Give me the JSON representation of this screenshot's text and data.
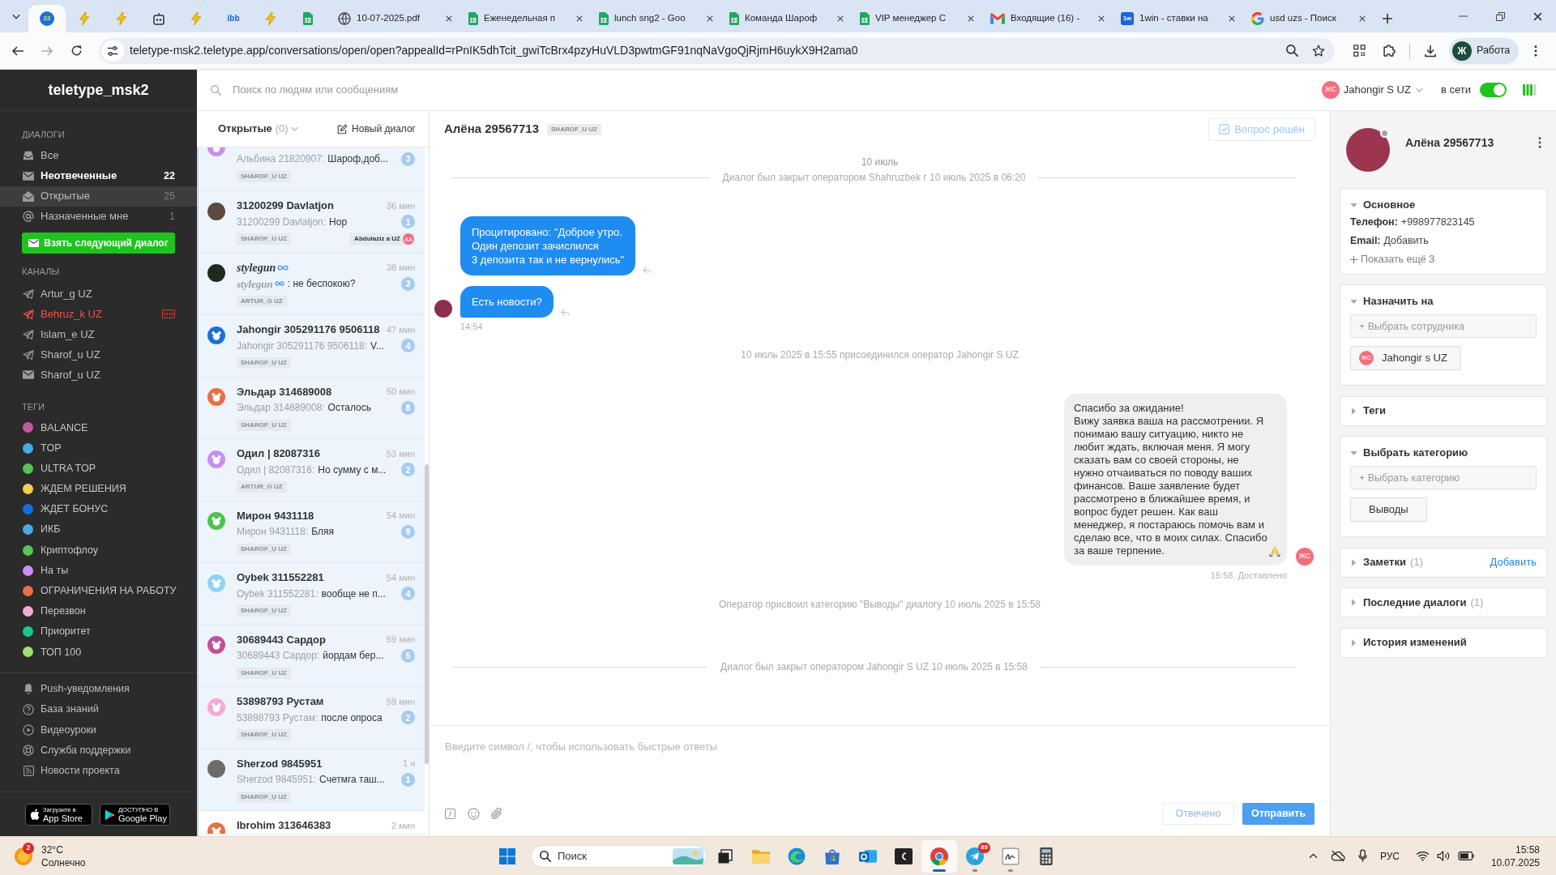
{
  "browser": {
    "pinned_tabs": [
      {
        "kind": "counter",
        "logo": "22",
        "selected": true
      },
      {
        "kind": "bolt",
        "selected": false
      },
      {
        "kind": "bolt",
        "selected": false
      },
      {
        "kind": "robot",
        "selected": false
      },
      {
        "kind": "bolt",
        "selected": false
      },
      {
        "kind": "text",
        "logo": "ibb",
        "selected": false
      },
      {
        "kind": "bolt",
        "selected": false
      },
      {
        "kind": "sheets",
        "selected": false
      }
    ],
    "tabs": [
      {
        "kind": "globe",
        "title": "10-07-2025.pdf",
        "selected": false
      },
      {
        "kind": "sheets",
        "title": "Еженедельная п",
        "selected": false
      },
      {
        "kind": "sheets",
        "title": "lunch sng2 - Goo",
        "selected": false
      },
      {
        "kind": "sheets",
        "title": "Команда Шароф",
        "selected": false
      },
      {
        "kind": "sheets",
        "title": "VIP менеджер С",
        "selected": false
      },
      {
        "kind": "gmail",
        "title": "Входящие (16) -",
        "selected": false
      },
      {
        "kind": "tile",
        "logo": "1w",
        "title": "1win - ставки на",
        "selected": false
      },
      {
        "kind": "google",
        "title": "usd uzs - Поиск",
        "selected": false
      }
    ],
    "url": "teletype-msk2.teletype.app/conversations/open/open?appealId=rPnIK5dhTcit_gwiTcBrx4pzyHuVLD3pwtmGF91nqNaVgoQjRjmH6uykX9H2ama0",
    "profile": {
      "initial": "Ж",
      "label": "Работа"
    }
  },
  "sidebar": {
    "title": "teletype_msk2",
    "dialogs_label": "ДИАЛОГИ",
    "dialogs": [
      {
        "kind": "inbox",
        "label": "Все",
        "selected": false,
        "highlighted": false
      },
      {
        "kind": "envelope",
        "label": "Неотвеченные",
        "count": "22",
        "selected": false,
        "highlighted": true
      },
      {
        "kind": "envelope_open",
        "label": "Открытые",
        "count": "25",
        "selected": true,
        "highlighted": false
      },
      {
        "kind": "at",
        "label": "Назначенные мне",
        "count": "1",
        "selected": false,
        "highlighted": false
      }
    ],
    "next_button": "Взять следующий диалог",
    "channels_label": "КАНАЛЫ",
    "channels": [
      {
        "kind": "telegram",
        "label": "Artur_g UZ",
        "alert": false
      },
      {
        "kind": "telegram",
        "label": "Behruz_k UZ",
        "alert": true
      },
      {
        "kind": "telegram",
        "label": "Islam_e UZ",
        "alert": false
      },
      {
        "kind": "telegram",
        "label": "Sharof_u UZ",
        "alert": false
      },
      {
        "kind": "email",
        "label": "Sharof_u UZ",
        "alert": false
      }
    ],
    "tags_label": "ТЕГИ",
    "tags": [
      {
        "label": "BALANCE",
        "color": "#c8579e"
      },
      {
        "label": "TOP",
        "color": "#45ace6"
      },
      {
        "label": "ULTRA TOP",
        "color": "#55c454"
      },
      {
        "label": "ЖДЕМ РЕШЕНИЯ",
        "color": "#f6cd54"
      },
      {
        "label": "ЖДЕТ БОНУС",
        "color": "#0f6fe0"
      },
      {
        "label": "ИКБ",
        "color": "#45ace6"
      },
      {
        "label": "Криптофлоу",
        "color": "#55c454"
      },
      {
        "label": "На ты",
        "color": "#c98ef2"
      },
      {
        "label": "ОГРАНИЧЕНИЯ НА РАБОТУ",
        "color": "#ea6f45"
      },
      {
        "label": "Перезвон",
        "color": "#f7aad5"
      },
      {
        "label": "Приоритет",
        "color": "#17c98b"
      },
      {
        "label": "ТОП 100",
        "color": "#9fe06b"
      }
    ],
    "links": [
      {
        "kind": "bell",
        "label": "Push-уведомления"
      },
      {
        "kind": "help",
        "label": "База знаний"
      },
      {
        "kind": "play",
        "label": "Видеоуроки"
      },
      {
        "kind": "lifebuoy",
        "label": "Служба поддержки"
      },
      {
        "kind": "rss",
        "label": "Новости проекта"
      }
    ],
    "stores": [
      {
        "kind": "apple",
        "caption": "Загрузите в",
        "label": "App Store"
      },
      {
        "kind": "google",
        "caption": "ДОСТУПНО В",
        "label": "Google Play"
      }
    ]
  },
  "topbar": {
    "search_placeholder": "Поиск по людям или сообщениям",
    "operator_initials": "ЖС",
    "operator_name": "Jahongir S UZ",
    "status_label": "в сети",
    "online": true
  },
  "conversations": {
    "filter": "Открытые",
    "filter_count": "(0)",
    "new_button": "Новый диалог",
    "items": [
      {
        "kind": "cut_top",
        "photo": false,
        "script": false,
        "infinity": false,
        "color": "#c98ef2",
        "author": "Альбина 21820907:",
        "text": "Шароф,доб...",
        "unread": "3",
        "channel": "SHAROF_U UZ",
        "highlighted": true
      },
      {
        "kind": "full",
        "photo": true,
        "script": false,
        "infinity": false,
        "color": "#5a4a40",
        "name": "31200299 Davlatjon",
        "time": "36 мин",
        "author": "31200299 Davlatjon:",
        "text": "Нор",
        "unread": "1",
        "channel": "SHAROF_U UZ",
        "assignee": {
          "name": "Abdulaziz a UZ",
          "initials": "AA"
        },
        "highlighted": true
      },
      {
        "kind": "full",
        "photo": true,
        "script": true,
        "infinity": true,
        "color": "#1d2a1c",
        "name": "stylegun",
        "time": "38 мин",
        "author": "stylegun",
        "text": ": не беспокою?",
        "unread": "3",
        "channel": "ARTUR_G UZ",
        "highlighted": true
      },
      {
        "kind": "full",
        "photo": false,
        "script": false,
        "infinity": false,
        "color": "#1a6fe0",
        "name": "Jahongir 305291176 9506118",
        "time": "47 мин",
        "author": "Jahongir 305291176 9506118:",
        "text": "V...",
        "unread": "4",
        "channel": "SHAROF_U UZ",
        "highlighted": true
      },
      {
        "kind": "full",
        "photo": false,
        "script": false,
        "infinity": false,
        "color": "#ea6f45",
        "name": "Эльдар 314689008",
        "time": "50 мин",
        "author": "Эльдар 314689008:",
        "text": "Осталось",
        "unread": "8",
        "channel": "SHAROF_U UZ",
        "highlighted": true
      },
      {
        "kind": "full",
        "photo": false,
        "script": false,
        "infinity": false,
        "color": "#c98ef2",
        "name": "Одил | 82087316",
        "time": "53 мин",
        "author": "Одил | 82087316:",
        "text": "Но сумму с м...",
        "unread": "2",
        "channel": "ARTUR_G UZ",
        "highlighted": true
      },
      {
        "kind": "full",
        "photo": false,
        "script": false,
        "infinity": false,
        "color": "#4cc44c",
        "name": "Мирон 9431118",
        "time": "54 мин",
        "author": "Мирон 9431118:",
        "text": "Бляя",
        "unread": "9",
        "channel": "SHAROF_U UZ",
        "highlighted": true
      },
      {
        "kind": "full",
        "photo": false,
        "script": false,
        "infinity": false,
        "color": "#8fd3f5",
        "name": "Oybek 311552281",
        "time": "54 мин",
        "author": "Oybek 311552281:",
        "text": "вообще не п...",
        "unread": "4",
        "channel": "SHAROF_U UZ",
        "highlighted": true
      },
      {
        "kind": "full",
        "photo": false,
        "script": false,
        "infinity": false,
        "color": "#c0509a",
        "name": "30689443 Сардор",
        "time": "59 мин",
        "author": "30689443 Сардор:",
        "text": "йордам бер...",
        "unread": "5",
        "channel": "SHAROF_U UZ",
        "highlighted": true
      },
      {
        "kind": "full",
        "photo": false,
        "script": false,
        "infinity": false,
        "color": "#f5a9d6",
        "name": "53898793 Рустам",
        "time": "59 мин",
        "author": "53898793 Рустам:",
        "text": "после опроса",
        "unread": "2",
        "channel": "SHAROF_U UZ",
        "highlighted": true
      },
      {
        "kind": "full",
        "photo": true,
        "script": false,
        "infinity": false,
        "color": "#6e6a66",
        "name": "Sherzod 9845951",
        "time": "1 ч",
        "author": "Sherzod 9845951:",
        "text": "Счетмга таш...",
        "unread": "1",
        "channel": "SHAROF_U UZ",
        "highlighted": true
      },
      {
        "kind": "cut_bottom",
        "photo": false,
        "script": false,
        "infinity": false,
        "color": "#ea6f45",
        "name": "Ibrohim 313646383",
        "time": "2 мин",
        "highlighted": false
      }
    ]
  },
  "chat": {
    "title": "Алёна 29567713",
    "channel": "SHAROF_U UZ",
    "resolve_button": {
      "label": "Вопрос решён",
      "disabled": true
    },
    "events": [
      {
        "kind": "date",
        "text": "10 июль"
      },
      {
        "kind": "divider",
        "text": "Диалог был закрыт оператором Shahruzbek г 10 июль 2025 в 06:20"
      },
      {
        "kind": "incoming",
        "text": "Процитировано: \"Доброе утро.\nОдин депозит зачислился\n3 депозита так и не вернулись\"",
        "avatar": false
      },
      {
        "kind": "incoming",
        "text": "Есть новости?",
        "avatar": true,
        "time": "14:54"
      },
      {
        "kind": "system",
        "text": "10 июль 2025 в 15:55 присоединился оператор Jahongir S UZ"
      },
      {
        "kind": "outgoing",
        "text": "Спасибо за ожидание!\nВижу заявка ваша на рассмотрении. Я понимаю вашу ситуацию, никто не любит ждать, включая меня. Я могу сказать вам со своей стороны, не нужно отчаиваться по поводу ваших финансов. Ваше заявление будет рассмотрено в ближайшее время, и вопрос будет решен. Как ваш менеджер, я постараюсь помочь вам и сделаю все, что в моих силах. Спасибо за ваше терпение.",
        "pray_icon": true,
        "initials": "ЖС",
        "status": "15:58. Доставлено"
      },
      {
        "kind": "system",
        "text": "Оператор присвоил категорию \"Выводы\" диалогу 10 июль 2025 в 15:58"
      },
      {
        "kind": "divider",
        "text": "Диалог был закрыт оператором Jahongir S UZ 10 июль 2025 в 15:58"
      }
    ],
    "input_placeholder": "Введите символ /, чтобы использовать быстрые ответы",
    "buttons": [
      {
        "kind": "secondary",
        "label": "Отвечено"
      },
      {
        "kind": "primary",
        "label": "Отправить"
      }
    ]
  },
  "contact": {
    "name": "Алёна 29567713",
    "online": false,
    "cards": [
      {
        "kind": "fields",
        "title": "Основное",
        "expanded": true,
        "fields": [
          {
            "label": "Телефон:",
            "value": "+998977823145"
          },
          {
            "label": "Email:",
            "value": "Добавить"
          }
        ],
        "more": "Показать ещё 3"
      },
      {
        "kind": "assign",
        "title": "Назначить на",
        "expanded": true,
        "placeholder": "+ Выбрать сотрудника",
        "chips": [
          {
            "initials": "ЖС",
            "label": "Jahongir s UZ"
          }
        ]
      },
      {
        "kind": "plain",
        "title": "Теги",
        "expanded": false
      },
      {
        "kind": "assign",
        "title": "Выбрать категорию",
        "expanded": true,
        "placeholder": "+ Выбрать категорию",
        "chips": [
          {
            "label": "Выводы"
          }
        ]
      },
      {
        "kind": "plain",
        "title": "Заметки",
        "count": "(1)",
        "action": "Добавить",
        "expanded": false
      },
      {
        "kind": "plain",
        "title": "Последние диалоги",
        "count": "(1)",
        "expanded": false
      },
      {
        "kind": "plain",
        "title": "История изменений",
        "expanded": false
      }
    ]
  },
  "taskbar": {
    "weather": {
      "badge": "2",
      "temperature": "32°C",
      "condition": "Солнечно"
    },
    "search_placeholder": "Поиск",
    "apps": [
      {
        "kind": "taskview",
        "selected": false,
        "running": false
      },
      {
        "kind": "explorer",
        "selected": false,
        "running": false
      },
      {
        "kind": "edge",
        "selected": false,
        "running": false
      },
      {
        "kind": "store",
        "selected": false,
        "running": false
      },
      {
        "kind": "outlook",
        "selected": false,
        "running": false
      },
      {
        "kind": "terminal",
        "selected": false,
        "running": false
      },
      {
        "kind": "chrome",
        "selected": true,
        "running": true
      },
      {
        "kind": "telegram",
        "badge": "89",
        "selected": false,
        "running": true
      },
      {
        "kind": "pen",
        "selected": false,
        "running": true
      },
      {
        "kind": "calculator",
        "selected": false,
        "running": false
      }
    ],
    "language": "РУС",
    "time": "15:58",
    "date": "10.07.2025"
  }
}
